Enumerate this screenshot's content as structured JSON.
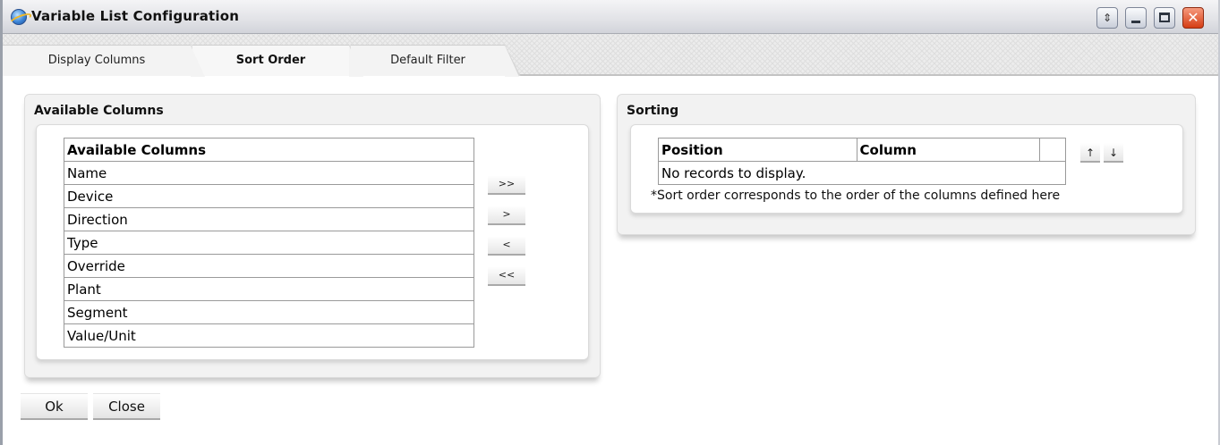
{
  "window": {
    "title": "Variable List Configuration",
    "buttons": {
      "restore_glyph": "⇕",
      "close_glyph": "✕"
    },
    "colors": {
      "close": "#d53d14"
    }
  },
  "tabs": [
    {
      "label": "Display Columns",
      "active": false
    },
    {
      "label": "Sort Order",
      "active": true
    },
    {
      "label": "Default Filter",
      "active": false
    }
  ],
  "available": {
    "panel_title": "Available Columns",
    "table_header": "Available Columns",
    "rows": [
      "Name",
      "Device",
      "Direction",
      "Type",
      "Override",
      "Plant",
      "Segment",
      "Value/Unit"
    ]
  },
  "move_buttons": {
    "add_all": ">>",
    "add": ">",
    "remove": "<",
    "remove_all": "<<"
  },
  "sorting": {
    "panel_title": "Sorting",
    "headers": {
      "position": "Position",
      "column": "Column",
      "extra": ""
    },
    "empty_message": "No records to display.",
    "note": "*Sort order corresponds to the order of the columns defined here",
    "up_glyph": "↑",
    "down_glyph": "↓"
  },
  "footer": {
    "ok": "Ok",
    "close": "Close"
  }
}
